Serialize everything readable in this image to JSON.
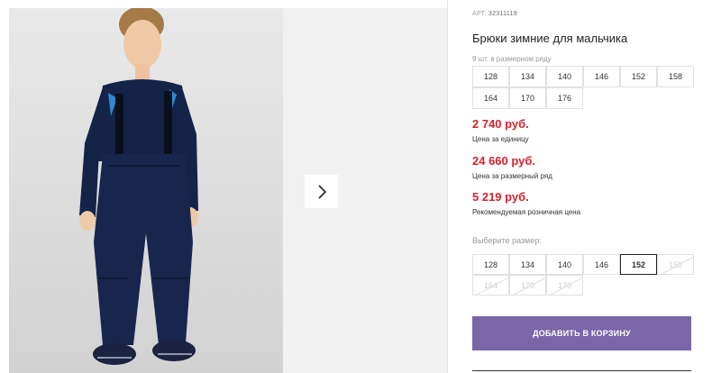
{
  "gallery": {
    "image_alt": "boy in navy winter trousers with suspenders",
    "next_icon": "chevron-right-icon"
  },
  "product": {
    "art_label": "АРТ.",
    "art_number": "32311119",
    "title": "Брюки зимние для мальчика",
    "qty_note": "9 шт. в размерном ряду",
    "sizes_row": [
      "128",
      "134",
      "140",
      "146",
      "152",
      "158",
      "164",
      "170",
      "176"
    ],
    "prices": [
      {
        "value": "2 740 руб.",
        "label": "Цена за единицу"
      },
      {
        "value": "24 660 руб.",
        "label": "Цена за размерный ряд"
      },
      {
        "value": "5 219 руб.",
        "label": "Рекомендуемая розничная цена"
      }
    ]
  },
  "size_picker": {
    "label": "Выберите размер:",
    "options": [
      {
        "size": "128",
        "state": "available"
      },
      {
        "size": "134",
        "state": "available"
      },
      {
        "size": "140",
        "state": "available"
      },
      {
        "size": "146",
        "state": "available"
      },
      {
        "size": "152",
        "state": "selected"
      },
      {
        "size": "158",
        "state": "disabled"
      },
      {
        "size": "164",
        "state": "disabled"
      },
      {
        "size": "170",
        "state": "disabled"
      },
      {
        "size": "176",
        "state": "disabled"
      }
    ]
  },
  "cart": {
    "add_label": "ДОБАВИТЬ В КОРЗИНУ"
  },
  "colors": {
    "accent": "#7b66a8",
    "price": "#d4232d"
  }
}
